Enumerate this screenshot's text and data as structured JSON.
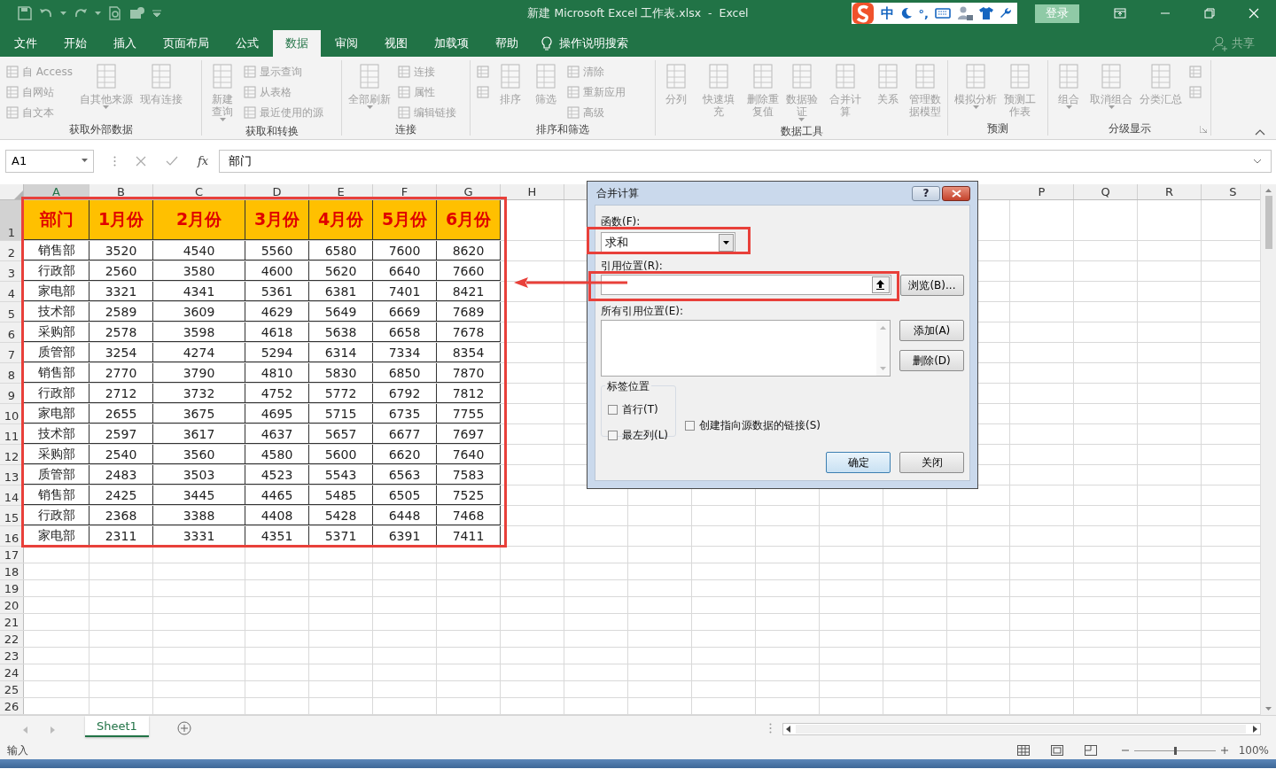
{
  "title_bar": {
    "title": "新建 Microsoft Excel 工作表.xlsx  -  Excel",
    "ime_mode": "中",
    "ime_punctuation": "°,",
    "sign_in": "登录"
  },
  "tabs": [
    {
      "label": "文件",
      "selected": false
    },
    {
      "label": "开始",
      "selected": false
    },
    {
      "label": "插入",
      "selected": false
    },
    {
      "label": "页面布局",
      "selected": false
    },
    {
      "label": "公式",
      "selected": false
    },
    {
      "label": "数据",
      "selected": true
    },
    {
      "label": "审阅",
      "selected": false
    },
    {
      "label": "视图",
      "selected": false
    },
    {
      "label": "加载项",
      "selected": false
    },
    {
      "label": "帮助",
      "selected": false
    }
  ],
  "tell_me": "操作说明搜索",
  "share": "共享",
  "ribbon": [
    {
      "label": "获取外部数据",
      "items": [
        {
          "kind": "stack",
          "items": [
            {
              "kind": "small",
              "label": "自 Access"
            },
            {
              "kind": "small",
              "label": "自网站"
            },
            {
              "kind": "small",
              "label": "自文本"
            }
          ]
        },
        {
          "kind": "large",
          "label": "自其他来源",
          "dropdown": true
        },
        {
          "kind": "large",
          "label": "现有连接",
          "dropdown": false
        }
      ]
    },
    {
      "label": "获取和转换",
      "items": [
        {
          "kind": "large",
          "label": "新建查询",
          "dropdown": true
        },
        {
          "kind": "stack",
          "items": [
            {
              "kind": "small",
              "label": "显示查询"
            },
            {
              "kind": "small",
              "label": "从表格"
            },
            {
              "kind": "small",
              "label": "最近使用的源"
            }
          ]
        }
      ]
    },
    {
      "label": "连接",
      "items": [
        {
          "kind": "large",
          "label": "全部刷新",
          "dropdown": true
        },
        {
          "kind": "stack",
          "items": [
            {
              "kind": "small",
              "label": "连接"
            },
            {
              "kind": "small",
              "label": "属性"
            },
            {
              "kind": "small",
              "label": "编辑链接"
            }
          ]
        }
      ]
    },
    {
      "label": "排序和筛选",
      "items": [
        {
          "kind": "stack",
          "items": [
            {
              "kind": "icon"
            },
            {
              "kind": "icon"
            }
          ]
        },
        {
          "kind": "large",
          "label": "排序",
          "dropdown": false
        },
        {
          "kind": "large",
          "label": "筛选",
          "dropdown": false
        },
        {
          "kind": "stack",
          "items": [
            {
              "kind": "small",
              "label": "清除"
            },
            {
              "kind": "small",
              "label": "重新应用"
            },
            {
              "kind": "small",
              "label": "高级"
            }
          ]
        }
      ]
    },
    {
      "label": "数据工具",
      "items": [
        {
          "kind": "large",
          "label": "分列",
          "dropdown": false
        },
        {
          "kind": "large",
          "label": "快速填充",
          "dropdown": false
        },
        {
          "kind": "large",
          "label": "删除重复值",
          "dropdown": false
        },
        {
          "kind": "large",
          "label": "数据验证",
          "dropdown": true
        },
        {
          "kind": "large",
          "label": "合并计算",
          "dropdown": false
        },
        {
          "kind": "large",
          "label": "关系",
          "dropdown": false
        },
        {
          "kind": "large",
          "label": "管理数据模型",
          "dropdown": false
        }
      ]
    },
    {
      "label": "预测",
      "items": [
        {
          "kind": "large",
          "label": "模拟分析",
          "dropdown": true
        },
        {
          "kind": "large",
          "label": "预测工作表",
          "dropdown": false
        }
      ]
    },
    {
      "label": "分级显示",
      "items": [
        {
          "kind": "large",
          "label": "组合",
          "dropdown": true
        },
        {
          "kind": "large",
          "label": "取消组合",
          "dropdown": true
        },
        {
          "kind": "large",
          "label": "分类汇总",
          "dropdown": false
        },
        {
          "kind": "stack",
          "items": [
            {
              "kind": "icon"
            },
            {
              "kind": "icon"
            }
          ]
        }
      ]
    }
  ],
  "formula_bar": {
    "name_box": "A1",
    "fx": "fx",
    "content": "部门"
  },
  "columns": [
    "A",
    "B",
    "C",
    "D",
    "E",
    "F",
    "G",
    "H",
    "P",
    "Q",
    "R",
    "S"
  ],
  "rows": [
    {
      "number": "1",
      "kind": "header",
      "cells": [
        "部门",
        "1月份",
        "2月份",
        "3月份",
        "4月份",
        "5月份",
        "6月份"
      ]
    },
    {
      "number": "2",
      "kind": "data",
      "cells": [
        "销售部",
        "3520",
        "4540",
        "5560",
        "6580",
        "7600",
        "8620"
      ]
    },
    {
      "number": "3",
      "kind": "data",
      "cells": [
        "行政部",
        "2560",
        "3580",
        "4600",
        "5620",
        "6640",
        "7660"
      ]
    },
    {
      "number": "4",
      "kind": "data",
      "cells": [
        "家电部",
        "3321",
        "4341",
        "5361",
        "6381",
        "7401",
        "8421"
      ]
    },
    {
      "number": "5",
      "kind": "data",
      "cells": [
        "技术部",
        "2589",
        "3609",
        "4629",
        "5649",
        "6669",
        "7689"
      ]
    },
    {
      "number": "6",
      "kind": "data",
      "cells": [
        "采购部",
        "2578",
        "3598",
        "4618",
        "5638",
        "6658",
        "7678"
      ]
    },
    {
      "number": "7",
      "kind": "data",
      "cells": [
        "质管部",
        "3254",
        "4274",
        "5294",
        "6314",
        "7334",
        "8354"
      ]
    },
    {
      "number": "8",
      "kind": "data",
      "cells": [
        "销售部",
        "2770",
        "3790",
        "4810",
        "5830",
        "6850",
        "7870"
      ]
    },
    {
      "number": "9",
      "kind": "data",
      "cells": [
        "行政部",
        "2712",
        "3732",
        "4752",
        "5772",
        "6792",
        "7812"
      ]
    },
    {
      "number": "10",
      "kind": "data",
      "cells": [
        "家电部",
        "2655",
        "3675",
        "4695",
        "5715",
        "6735",
        "7755"
      ]
    },
    {
      "number": "11",
      "kind": "data",
      "cells": [
        "技术部",
        "2597",
        "3617",
        "4637",
        "5657",
        "6677",
        "7697"
      ]
    },
    {
      "number": "12",
      "kind": "data",
      "cells": [
        "采购部",
        "2540",
        "3560",
        "4580",
        "5600",
        "6620",
        "7640"
      ]
    },
    {
      "number": "13",
      "kind": "data",
      "cells": [
        "质管部",
        "2483",
        "3503",
        "4523",
        "5543",
        "6563",
        "7583"
      ]
    },
    {
      "number": "14",
      "kind": "data",
      "cells": [
        "销售部",
        "2425",
        "3445",
        "4465",
        "5485",
        "6505",
        "7525"
      ]
    },
    {
      "number": "15",
      "kind": "data",
      "cells": [
        "行政部",
        "2368",
        "3388",
        "4408",
        "5428",
        "6448",
        "7468"
      ]
    },
    {
      "number": "16",
      "kind": "data",
      "cells": [
        "家电部",
        "2311",
        "3331",
        "4351",
        "5371",
        "6391",
        "7411"
      ]
    },
    {
      "number": "17",
      "kind": "empty"
    },
    {
      "number": "18",
      "kind": "empty"
    },
    {
      "number": "19",
      "kind": "empty"
    },
    {
      "number": "20",
      "kind": "empty"
    },
    {
      "number": "21",
      "kind": "empty"
    },
    {
      "number": "22",
      "kind": "empty"
    },
    {
      "number": "23",
      "kind": "empty"
    },
    {
      "number": "24",
      "kind": "empty"
    },
    {
      "number": "25",
      "kind": "empty"
    },
    {
      "number": "26",
      "kind": "empty"
    }
  ],
  "dialog": {
    "title": "合并计算",
    "help": "?",
    "function_label": "函数(F):",
    "function_value": "求和",
    "reference_label": "引用位置(R):",
    "browse_button": "浏览(B)...",
    "all_references_label": "所有引用位置(E):",
    "add_button": "添加(A)",
    "delete_button": "删除(D)",
    "label_group": "标签位置",
    "checkboxes": [
      {
        "label": "首行(T)",
        "checked": false
      },
      {
        "label": "最左列(L)",
        "checked": false
      },
      {
        "label": "创建指向源数据的链接(S)",
        "checked": false
      }
    ],
    "ok_button": "确定",
    "close_button": "关闭"
  },
  "sheet_tabs": [
    {
      "label": "Sheet1",
      "selected": true
    }
  ],
  "status_bar": {
    "mode": "输入",
    "zoom": {
      "level": 0.5,
      "reading": "100%"
    }
  }
}
